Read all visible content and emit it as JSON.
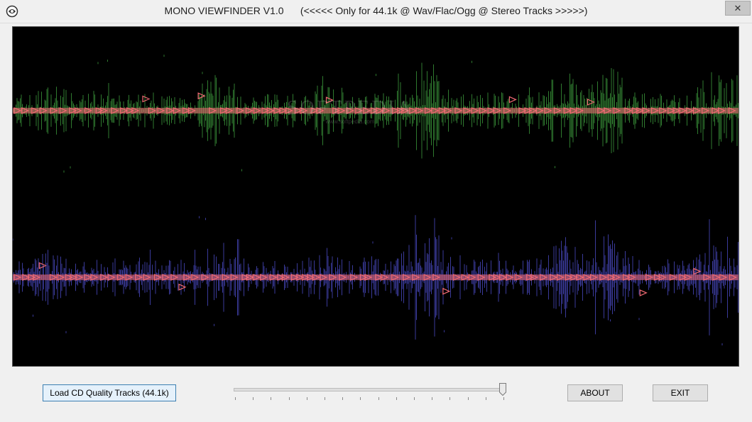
{
  "window": {
    "title": "MONO VIEWFINDER V1.0      (<<<<< Only for 44.1k @ Wav/Flac/Ogg @ Stereo Tracks >>>>>)",
    "close_glyph": "✕"
  },
  "colors": {
    "background": "#000000",
    "left_channel": "#2f7a2f",
    "right_channel": "#3a3a9a",
    "markers": "#f06a73",
    "window": "#f0f0f0"
  },
  "controls": {
    "load_label": "Load CD Quality Tracks (44.1k)",
    "about_label": "ABOUT",
    "exit_label": "EXIT",
    "slider_value": 1.0
  },
  "watermark": {
    "text": "SOFTPEDIA",
    "sub": "www.softpedia.com"
  },
  "icons": {
    "app": "app-logo-icon",
    "close": "close-icon"
  }
}
